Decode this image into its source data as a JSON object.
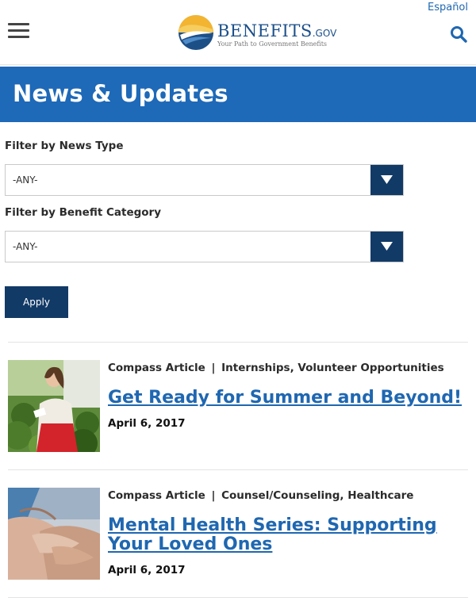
{
  "header": {
    "espanol_link": "Español",
    "logo": {
      "name": "BENEFITS",
      "suffix": ".GOV",
      "tagline": "Your Path to Government Benefits"
    }
  },
  "banner": {
    "title": "News & Updates"
  },
  "filters": {
    "news_type": {
      "label": "Filter by News Type",
      "value": "-ANY-"
    },
    "benefit_category": {
      "label": "Filter by Benefit Category",
      "value": "-ANY-"
    },
    "apply_label": "Apply"
  },
  "articles": [
    {
      "type": "Compass Article",
      "separator": "|",
      "categories": "Internships, Volunteer Opportunities",
      "title": "Get Ready for Summer and Beyond!",
      "date": "April 6, 2017"
    },
    {
      "type": "Compass Article",
      "separator": "|",
      "categories": "Counsel/Counseling, Healthcare",
      "title": "Mental Health Series: Supporting Your Loved Ones",
      "date": "April 6, 2017"
    }
  ],
  "colors": {
    "banner": "#1e69b8",
    "dark_button": "#123a66",
    "link": "#1f67b1"
  }
}
